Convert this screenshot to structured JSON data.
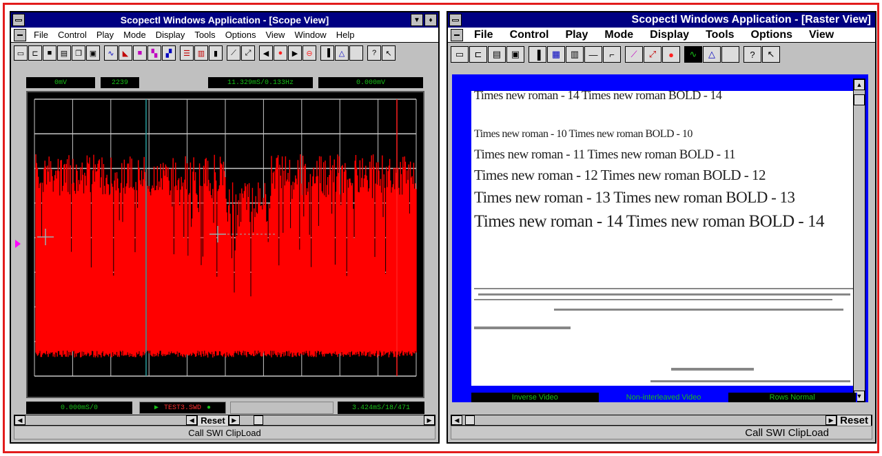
{
  "scope_window": {
    "title": "Scopectl Windows Application - [Scope View]",
    "menu": [
      "File",
      "Control",
      "Play",
      "Mode",
      "Display",
      "Tools",
      "Options",
      "View",
      "Window",
      "Help"
    ],
    "readouts": [
      "0mV",
      "2239",
      "11.329mS/0.133Hz",
      "0.000mV"
    ],
    "bottom_readouts": [
      "0.000mS/0",
      "TEST3.SWD",
      "3.424mS/18/471"
    ],
    "reset_label": "Reset",
    "status": "Call SWI ClipLoad",
    "colors": {
      "trace": "#ff0000",
      "grid": "#c8c8c8",
      "background": "#000000",
      "readout_text": "#18c018"
    }
  },
  "raster_window": {
    "title": "Scopectl Windows Application - [Raster View]",
    "menu": [
      "File",
      "Control",
      "Play",
      "Mode",
      "Display",
      "Tools",
      "Options",
      "View"
    ],
    "document_lines": [
      "Times new roman - 14 Times new roman BOLD - 14",
      "Times new roman - 10 Times new roman BOLD - 10",
      "Times new roman - 11 Times new roman BOLD - 11",
      "Times new roman - 12 Times new roman BOLD - 12",
      "Times new roman - 13 Times new roman BOLD - 13",
      "Times new roman - 14 Times new roman BOLD - 14"
    ],
    "modes": [
      "Inverse Video",
      "Non-interleaved Video",
      "Rows Normal"
    ],
    "reset_label": "Reset",
    "status": "Call SWI ClipLoad",
    "colors": {
      "frame": "#0000ff",
      "page": "#ffffff"
    }
  }
}
